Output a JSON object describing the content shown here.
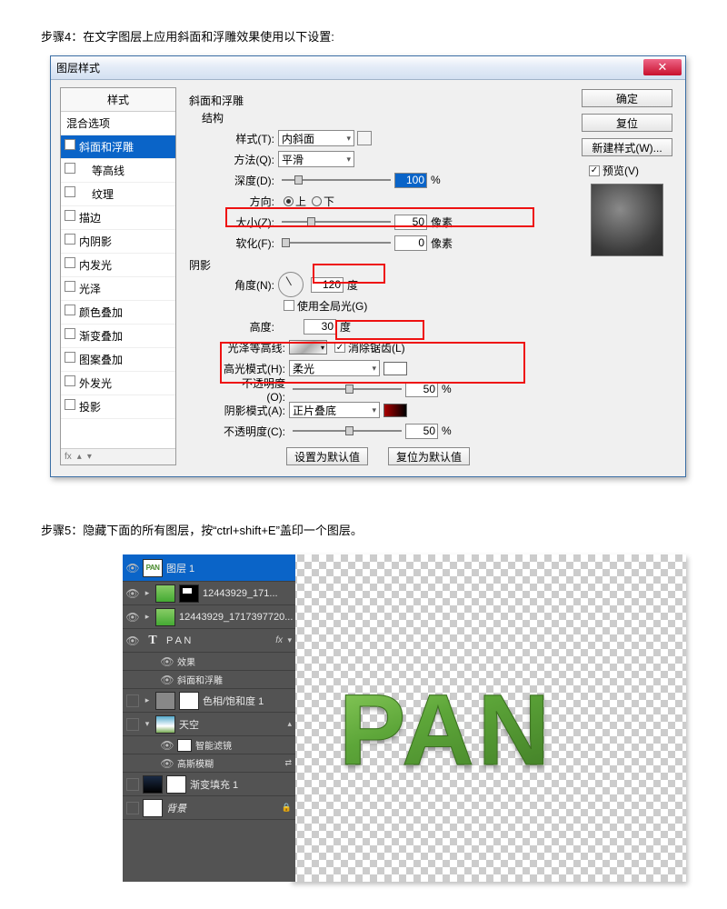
{
  "step4": "步骤4：在文字图层上应用斜面和浮雕效果使用以下设置:",
  "dialog": {
    "title": "图层样式",
    "left": {
      "header": "样式",
      "blend": "混合选项",
      "items": [
        {
          "label": "斜面和浮雕",
          "checked": true,
          "selected": true
        },
        {
          "label": "等高线",
          "sub": true,
          "checked": false
        },
        {
          "label": "纹理",
          "sub": true,
          "checked": false
        },
        {
          "label": "描边",
          "checked": false
        },
        {
          "label": "内阴影",
          "checked": false
        },
        {
          "label": "内发光",
          "checked": false
        },
        {
          "label": "光泽",
          "checked": false
        },
        {
          "label": "颜色叠加",
          "checked": false
        },
        {
          "label": "渐变叠加",
          "checked": false
        },
        {
          "label": "图案叠加",
          "checked": false
        },
        {
          "label": "外发光",
          "checked": false
        },
        {
          "label": "投影",
          "checked": false
        }
      ],
      "foot": "fx"
    },
    "center": {
      "section": "斜面和浮雕",
      "structure": "结构",
      "style_lbl": "样式(T):",
      "style_val": "内斜面",
      "technique_lbl": "方法(Q):",
      "technique_val": "平滑",
      "depth_lbl": "深度(D):",
      "depth_val": "100",
      "depth_unit": "%",
      "direction_lbl": "方向:",
      "dir_up": "上",
      "dir_down": "下",
      "size_lbl": "大小(Z):",
      "size_val": "50",
      "size_unit": "像素",
      "soften_lbl": "软化(F):",
      "soften_val": "0",
      "soften_unit": "像素",
      "shading": "阴影",
      "angle_lbl": "角度(N):",
      "angle_val": "120",
      "angle_unit": "度",
      "global_light": "使用全局光(G)",
      "altitude_lbl": "高度:",
      "altitude_val": "30",
      "altitude_unit": "度",
      "gloss_lbl": "光泽等高线:",
      "antialias": "消除锯齿(L)",
      "hl_mode_lbl": "高光模式(H):",
      "hl_mode_val": "柔光",
      "hl_opacity_lbl": "不透明度(O):",
      "hl_opacity_val": "50",
      "hl_opacity_unit": "%",
      "sh_mode_lbl": "阴影模式(A):",
      "sh_mode_val": "正片叠底",
      "sh_opacity_lbl": "不透明度(C):",
      "sh_opacity_val": "50",
      "sh_opacity_unit": "%",
      "btn_default": "设置为默认值",
      "btn_reset": "复位为默认值"
    },
    "right": {
      "ok": "确定",
      "cancel": "复位",
      "new_style": "新建样式(W)...",
      "preview": "预览(V)"
    }
  },
  "step5": "步骤5：隐藏下面的所有图层，按“ctrl+shift+E”盖印一个图层。",
  "layers": {
    "top": "图层 1",
    "r1": "12443929_171...",
    "r2": "12443929_1717397720...",
    "r3": "P A N",
    "fx": "fx",
    "effects": "效果",
    "bevel": "斜面和浮雕",
    "hue": "色相/饱和度 1",
    "sky": "天空",
    "smart": "智能滤镜",
    "gauss": "高斯模糊",
    "gradfill": "渐变填充 1",
    "bg": "背景"
  },
  "pan": "PAN"
}
